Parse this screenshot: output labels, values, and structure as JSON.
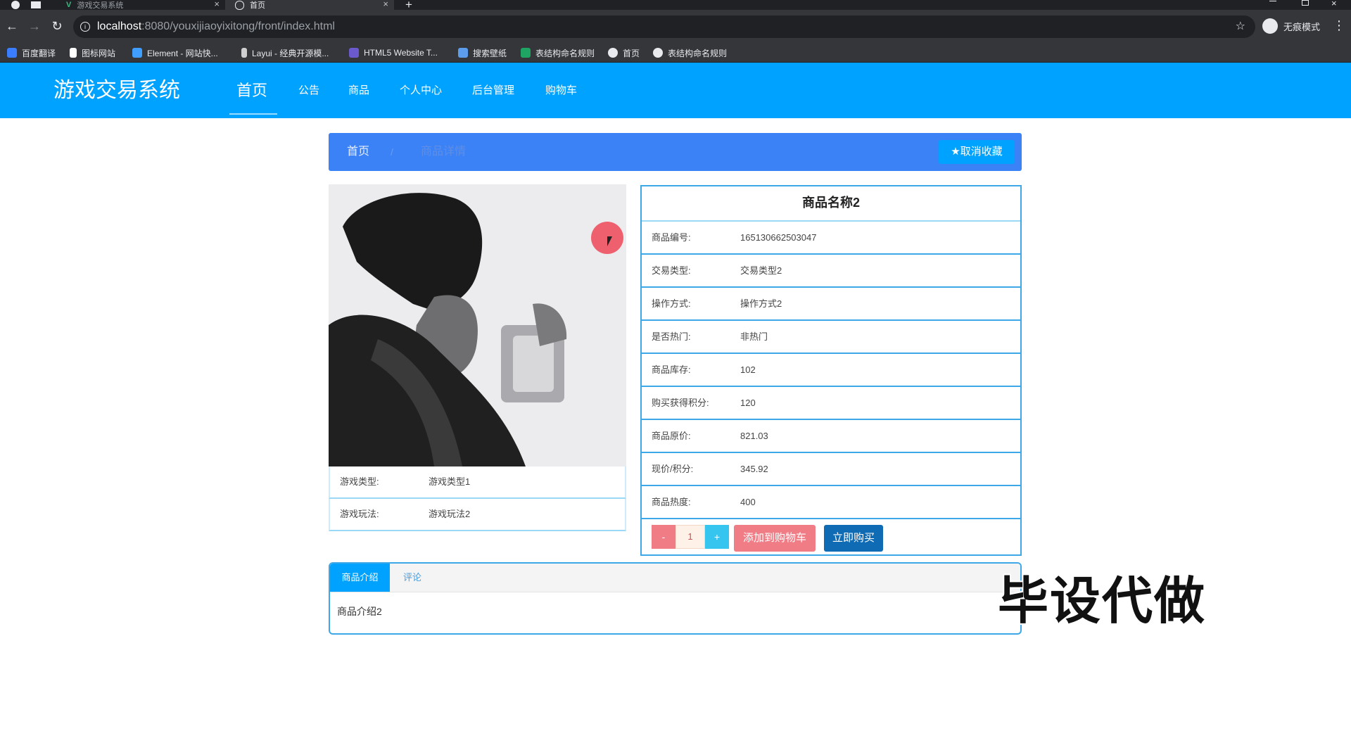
{
  "browser": {
    "tabs": [
      {
        "label": "游戏交易系统",
        "active": false
      },
      {
        "label": "首页",
        "active": true
      }
    ],
    "new_tab": "+",
    "url_host": "localhost",
    "url_path": ":8080/youxijiaoyixitong/front/index.html",
    "incognito_label": "无痕模式",
    "bookmarks": [
      {
        "label": "百度翻译",
        "icon": "translate-icon",
        "color": "#3b7dff"
      },
      {
        "label": "图标网站",
        "icon": "flag-icon",
        "color": "#ffffff"
      },
      {
        "label": "Element - 网站快...",
        "icon": "element-icon",
        "color": "#409eff"
      },
      {
        "label": "Layui - 经典开源模...",
        "icon": "layui-icon",
        "color": "#cfcfcf"
      },
      {
        "label": "HTML5 Website T...",
        "icon": "html5-icon",
        "color": "#6a5acd"
      },
      {
        "label": "搜索壁纸",
        "icon": "wallpaper-icon",
        "color": "#5c9ded"
      },
      {
        "label": "表结构命名规则",
        "icon": "sheet-icon",
        "color": "#1fa463"
      },
      {
        "label": "首页",
        "icon": "globe-icon",
        "color": "#e8eaed"
      },
      {
        "label": "表结构命名规则",
        "icon": "globe-icon",
        "color": "#e8eaed"
      }
    ]
  },
  "site": {
    "logo": "游戏交易系统",
    "nav": [
      "首页",
      "公告",
      "商品",
      "个人中心",
      "后台管理",
      "购物车"
    ],
    "active_nav": "首页",
    "brand_color": "#00a2ff"
  },
  "breadcrumb": {
    "home": "首页",
    "separator": "/",
    "current": "商品详情",
    "favorite_button": "取消收藏"
  },
  "product": {
    "name": "商品名称2",
    "left_info": [
      {
        "label": "游戏类型:",
        "value": "游戏类型1"
      },
      {
        "label": "游戏玩法:",
        "value": "游戏玩法2"
      }
    ],
    "details": [
      {
        "label": "商品编号:",
        "value": "165130662503047"
      },
      {
        "label": "交易类型:",
        "value": "交易类型2"
      },
      {
        "label": "操作方式:",
        "value": "操作方式2"
      },
      {
        "label": "是否热门:",
        "value": "非热门"
      },
      {
        "label": "商品库存:",
        "value": "102"
      },
      {
        "label": "购买获得积分:",
        "value": "120"
      },
      {
        "label": "商品原价:",
        "value": "821.03"
      },
      {
        "label": "现价/积分:",
        "value": "345.92"
      },
      {
        "label": "商品热度:",
        "value": "400"
      }
    ],
    "quantity": {
      "minus": "-",
      "value": "1",
      "plus": "+"
    },
    "add_to_cart": "添加到购物车",
    "buy_now": "立即购买"
  },
  "tabs": {
    "items": [
      "商品介绍",
      "评论"
    ],
    "active": "商品介绍",
    "content": "商品介绍2"
  },
  "watermark": "毕设代做"
}
